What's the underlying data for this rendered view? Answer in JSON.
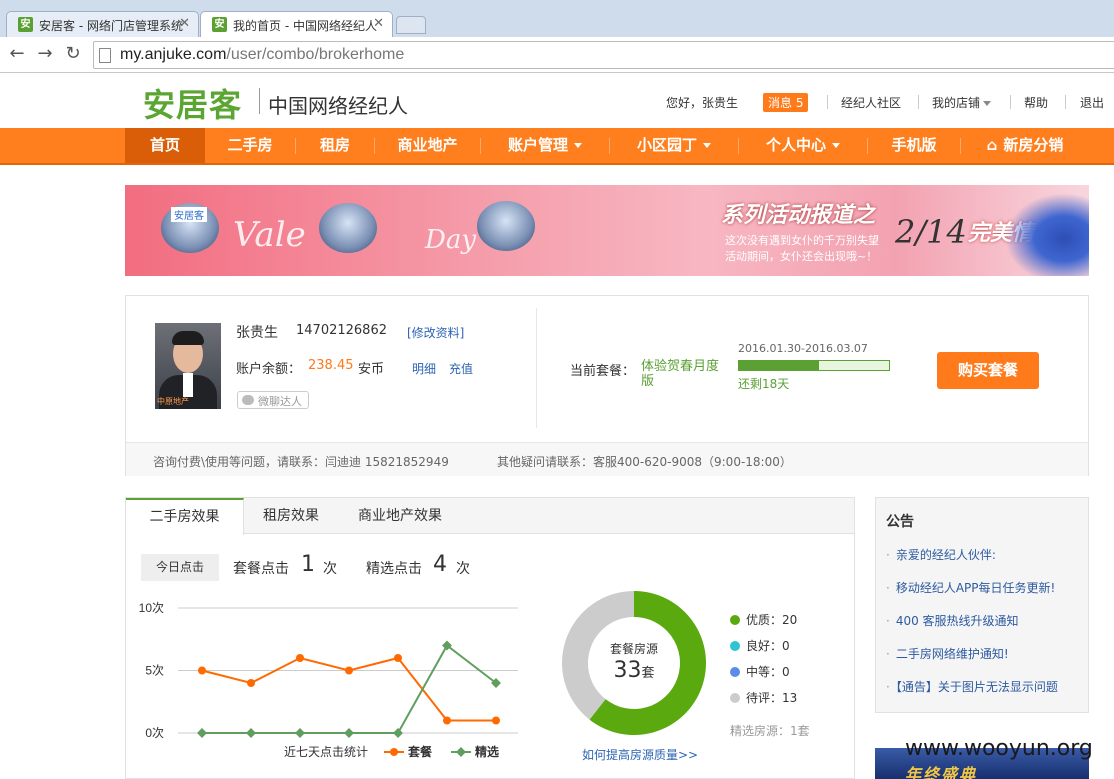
{
  "browser": {
    "tabs": [
      {
        "title": "安居客 - 网络门店管理系统",
        "favicon": "安",
        "active": false
      },
      {
        "title": "我的首页 - 中国网络经纪人",
        "favicon": "安",
        "active": true
      }
    ],
    "url_host": "my.anjuke.com",
    "url_path": "/user/combo/brokerhome"
  },
  "header": {
    "logo": "安居客",
    "subtitle": "中国网络经纪人",
    "greeting": "您好，张贵生",
    "messages_label": "消息",
    "messages_count": "5",
    "links": [
      "经纪人社区",
      "我的店铺",
      "帮助",
      "退出"
    ]
  },
  "nav": {
    "items": [
      "首页",
      "二手房",
      "租房",
      "商业地产",
      "账户管理",
      "小区园丁",
      "个人中心",
      "手机版",
      "新房分销"
    ],
    "active_index": 0,
    "dropdown_items": [
      "账户管理",
      "小区园丁",
      "个人中心"
    ]
  },
  "banner": {
    "script_left": "Vale",
    "script_right": "Day",
    "title": "系列活动报道之",
    "text_line1": "这次没有遇到女仆的千万别失望",
    "text_line2": "活动期间，女仆还会出现哦~！",
    "date": "2/14",
    "love": "完美情人",
    "sign_text": "安居客"
  },
  "account": {
    "name": "张贵生",
    "phone": "14702126862",
    "edit_link": "[修改资料]",
    "balance_label": "账户余额：",
    "balance_value": "238.45",
    "balance_unit": "安币",
    "detail_link": "明细",
    "recharge_link": "充值",
    "wechat_badge": "微聊达人",
    "plan_label": "当前套餐：",
    "plan_name": "体验贺春月度版",
    "plan_dates": "2016.01.30-2016.03.07",
    "plan_progress_fraction": 0.53,
    "plan_remaining": "还剩18天",
    "buy_button": "购买套餐",
    "contact_left": "咨询付费\\使用等问题，请联系：闫迪迪  15821852949",
    "contact_right": "其他疑问请联系：客服400-620-9008（9:00-18:00）",
    "avatar_caption": "中原地产"
  },
  "stats": {
    "tabs": [
      "二手房效果",
      "租房效果",
      "商业地产效果"
    ],
    "active_tab": 0,
    "today_label": "今日点击",
    "combo_click_label": "套餐点击",
    "combo_click_value": "1",
    "combo_click_unit": "次",
    "selected_click_label": "精选点击",
    "selected_click_value": "4",
    "selected_click_unit": "次",
    "improve_link": "如何提高房源质量>>",
    "selected_count": "精选房源：1套"
  },
  "chart_data": [
    {
      "type": "line",
      "title": "近七天点击统计",
      "x": [
        1,
        2,
        3,
        4,
        5,
        6,
        7
      ],
      "yticks": [
        "0次",
        "5次",
        "10次"
      ],
      "ylim": [
        0,
        10
      ],
      "grid": true,
      "legend_position": "bottom",
      "series": [
        {
          "name": "套餐",
          "color": "#ff6a00",
          "values": [
            5,
            4,
            6,
            5,
            6,
            1,
            1
          ]
        },
        {
          "name": "精选",
          "color": "#5f9e5f",
          "values": [
            0,
            0,
            0,
            0,
            0,
            7,
            4
          ]
        }
      ]
    },
    {
      "type": "pie",
      "title": "套餐房源",
      "total": 33,
      "total_unit": "套",
      "slices": [
        {
          "label": "优质",
          "value": 20,
          "color": "#5aa90e"
        },
        {
          "label": "良好",
          "value": 0,
          "color": "#2ec4d0"
        },
        {
          "label": "中等",
          "value": 0,
          "color": "#5b8de6"
        },
        {
          "label": "待评",
          "value": 13,
          "color": "#cccccc"
        }
      ]
    }
  ],
  "notice": {
    "title": "公告",
    "items": [
      "亲爱的经纪人伙伴:",
      "移动经纪人APP每日任务更新!",
      "400 客服热线升级通知",
      "二手房网络维护通知!",
      "【通告】关于图片无法显示问题"
    ]
  },
  "ad": {
    "text": "年终盛典"
  },
  "watermark": "www.wooyun.org"
}
